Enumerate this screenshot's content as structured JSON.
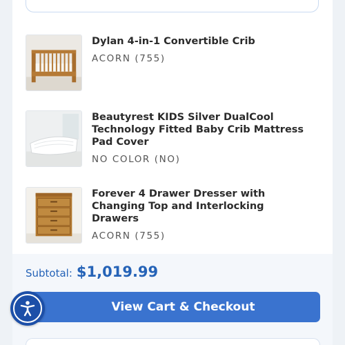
{
  "cart": {
    "items": [
      {
        "name": "Dylan 4-in-1 Convertible Crib",
        "variant": "ACORN (755)",
        "image_icon": "crib-image"
      },
      {
        "name": "Beautyrest KIDS Silver DualCool Technology Fitted Baby Crib Mattress Pad Cover",
        "variant": "NO COLOR (NO)",
        "image_icon": "mattress-pad-image"
      },
      {
        "name": "Forever 4 Drawer Dresser with Changing Top and Interlocking Drawers",
        "variant": "ACORN (755)",
        "image_icon": "dresser-image"
      }
    ]
  },
  "footer": {
    "subtotal_label": "Subtotal:",
    "subtotal_value": "$1,019.99",
    "checkout_label": "View Cart & Checkout"
  },
  "colors": {
    "accent": "#3a73cf",
    "price": "#2563b7",
    "a11y_button": "#1c4fa8"
  }
}
